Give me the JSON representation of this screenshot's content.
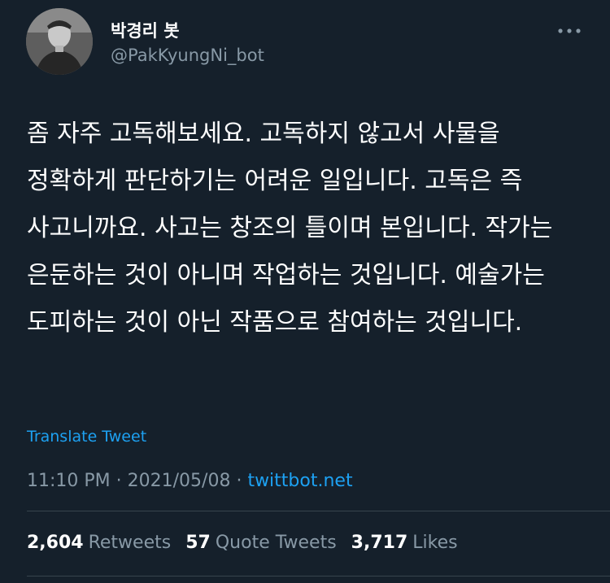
{
  "author": {
    "display_name": "박경리 봇",
    "handle": "@PakKyungNi_bot",
    "avatar_icon": "profile-photo"
  },
  "menu": {
    "icon": "more-dots-icon"
  },
  "tweet": {
    "text": "좀 자주 고독해보세요. 고독하지 않고서 사물을 정확하게 판단하기는 어려운 일입니다. 고독은 즉 사고니까요. 사고는 창조의 틀이며 본입니다. 작가는 은둔하는 것이 아니며 작업하는 것입니다. 예술가는 도피하는 것이 아닌 작품으로 참여하는 것입니다.",
    "translate_label": "Translate Tweet"
  },
  "meta": {
    "time": "11:10 PM",
    "sep1": " · ",
    "date": "2021/05/08",
    "sep2": " · ",
    "source": "twittbot.net"
  },
  "stats": {
    "retweets_count": "2,604",
    "retweets_label": "Retweets",
    "quotes_count": "57",
    "quotes_label": "Quote Tweets",
    "likes_count": "3,717",
    "likes_label": "Likes"
  },
  "colors": {
    "background": "#15202b",
    "text": "#ffffff",
    "secondary": "#8899a6",
    "link": "#1da1f2",
    "divider": "#38444d"
  }
}
